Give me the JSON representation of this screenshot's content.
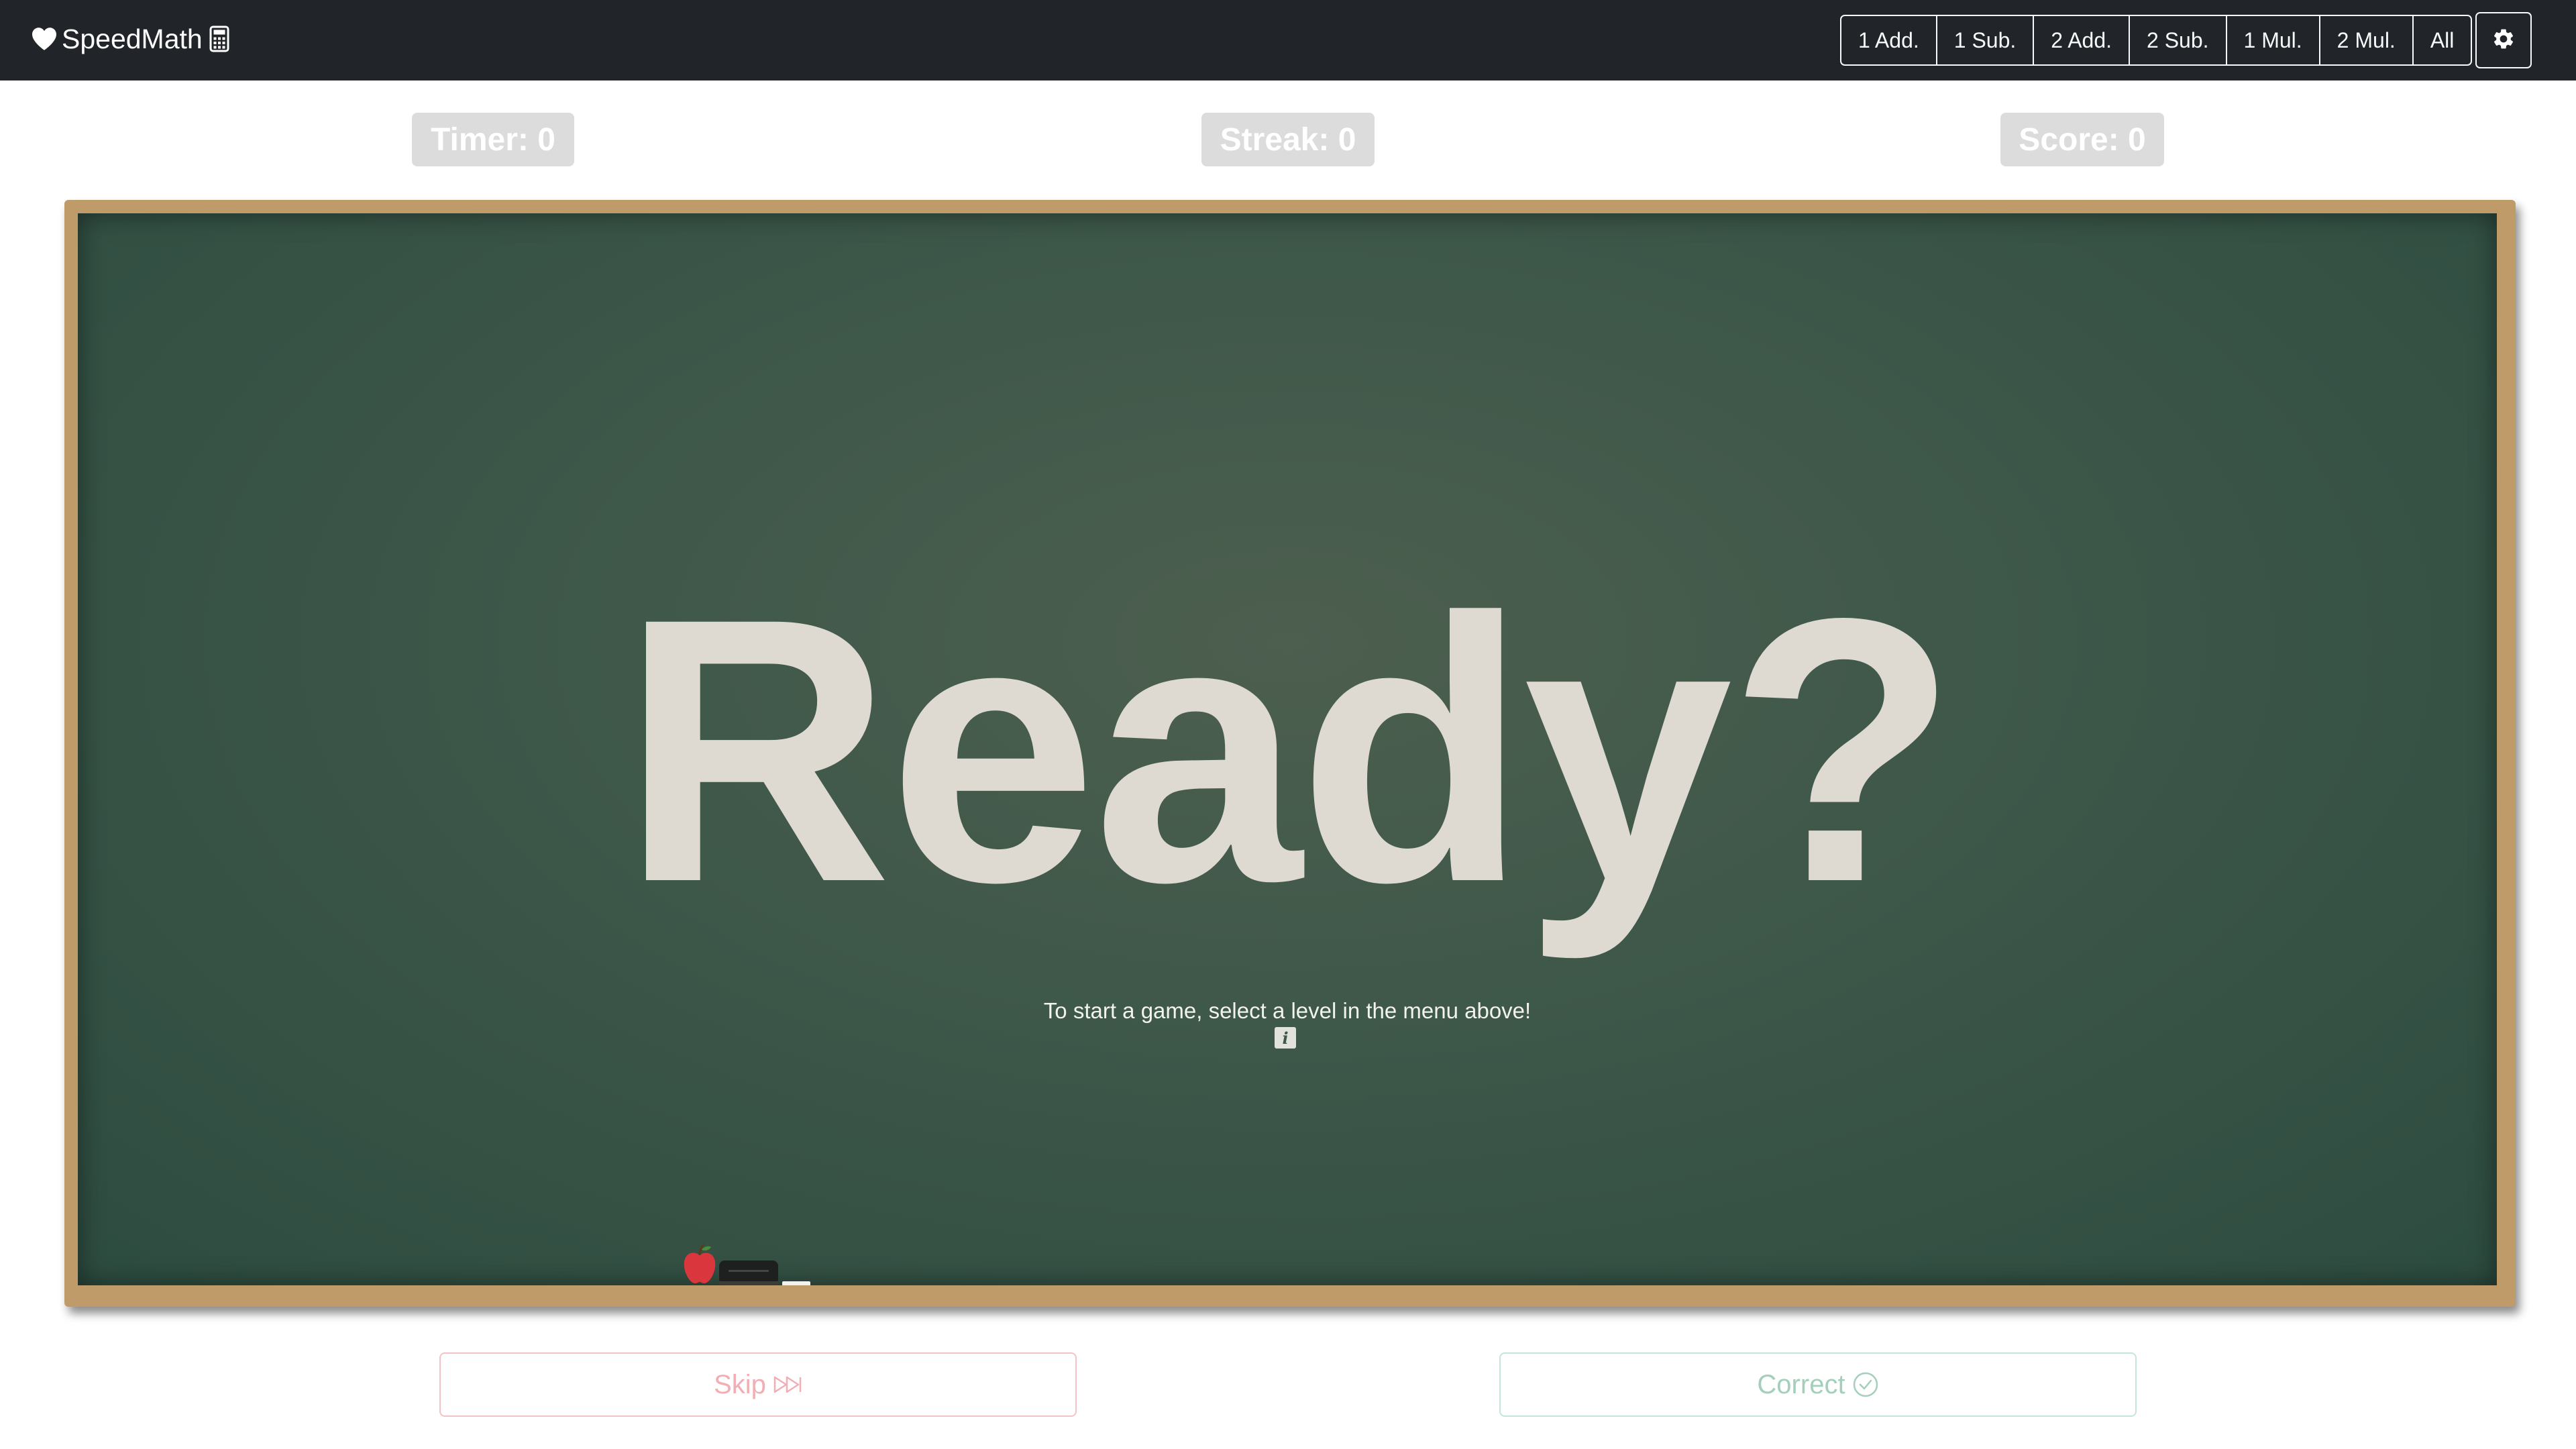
{
  "navbar": {
    "brand_name": "SpeedMath",
    "brand_icons": [
      "heart-icon",
      "calculator-icon"
    ],
    "levels": [
      {
        "label": "1 Add."
      },
      {
        "label": "1 Sub."
      },
      {
        "label": "2 Add."
      },
      {
        "label": "2 Sub."
      },
      {
        "label": "1 Mul."
      },
      {
        "label": "2 Mul."
      },
      {
        "label": "All"
      }
    ],
    "settings_icon": "gear-icon"
  },
  "stats": {
    "timer": "Timer: 0",
    "streak": "Streak: 0",
    "score": "Score: 0"
  },
  "board": {
    "headline": "Ready?",
    "instruction": "To start a game, select a level in the menu above!",
    "info_label": "i",
    "decorations": [
      "apple-icon",
      "eraser",
      "chalk"
    ]
  },
  "actions": {
    "skip_label": "Skip",
    "skip_icon": "fast-forward-icon",
    "correct_label": "Correct",
    "correct_icon": "check-circle-icon"
  },
  "colors": {
    "navbar_bg": "#212529",
    "board_green": "#3d5749",
    "frame_wood": "#bf9b6a",
    "chalk_text": "#dedad1",
    "stat_bg": "#dcdcdc",
    "skip_color": "#f1aeb5",
    "correct_color": "#a3cfbb"
  }
}
